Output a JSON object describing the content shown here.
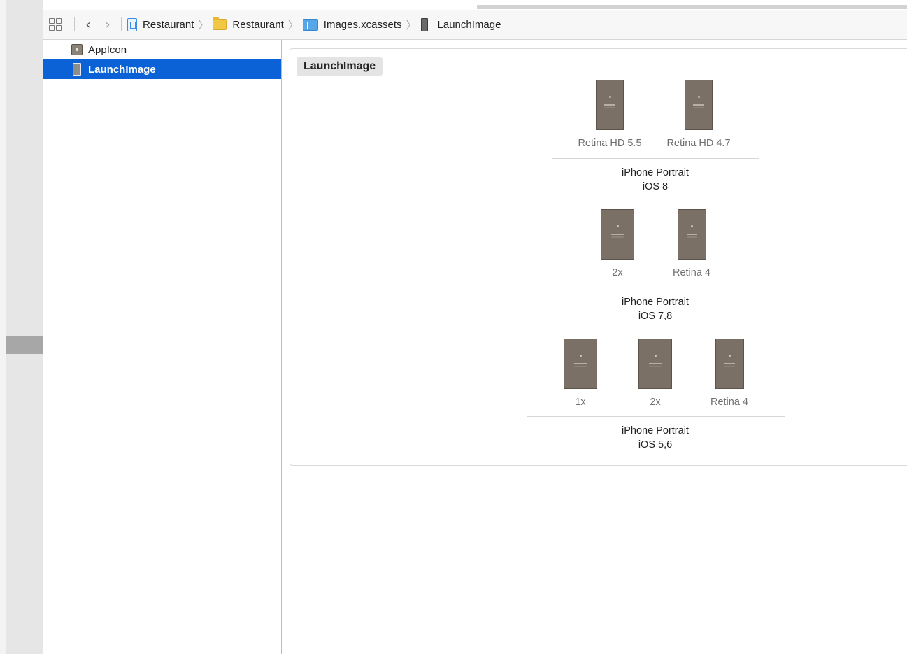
{
  "breadcrumb": {
    "items": [
      {
        "label": "Restaurant",
        "icon": "project-file-icon"
      },
      {
        "label": "Restaurant",
        "icon": "folder-icon"
      },
      {
        "label": "Images.xcassets",
        "icon": "asset-catalog-icon"
      },
      {
        "label": "LaunchImage",
        "icon": "launch-image-icon"
      }
    ]
  },
  "navigator": {
    "items": [
      {
        "label": "AppIcon",
        "selected": false
      },
      {
        "label": "LaunchImage",
        "selected": true
      }
    ]
  },
  "editor": {
    "set_name": "LaunchImage",
    "groups": [
      {
        "slots": [
          "Retina HD 5.5",
          "Retina HD 4.7"
        ],
        "device": "iPhone Portrait",
        "os": "iOS 8"
      },
      {
        "slots": [
          "2x",
          "Retina 4"
        ],
        "device": "iPhone Portrait",
        "os": "iOS 7,8"
      },
      {
        "slots": [
          "1x",
          "2x",
          "Retina 4"
        ],
        "device": "iPhone Portrait",
        "os": "iOS 5,6"
      }
    ]
  },
  "colors": {
    "selection": "#0a62d6",
    "thumbnail": "#7b7065"
  }
}
